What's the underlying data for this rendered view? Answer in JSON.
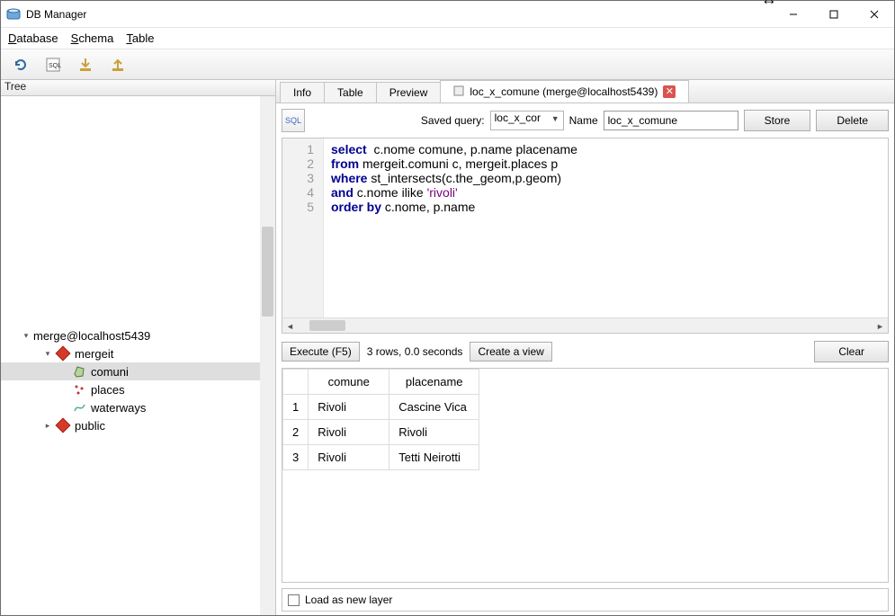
{
  "window": {
    "title": "DB Manager"
  },
  "menu": {
    "database": "Database",
    "schema": "Schema",
    "table": "Table"
  },
  "tree": {
    "header": "Tree",
    "connection": "merge@localhost5439",
    "schema_mergeit": "mergeit",
    "tbl_comuni": "comuni",
    "tbl_places": "places",
    "tbl_waterways": "waterways",
    "schema_public": "public"
  },
  "tabs": {
    "info": "Info",
    "table": "Table",
    "preview": "Preview",
    "query": "loc_x_comune (merge@localhost5439)"
  },
  "query": {
    "saved_query_label": "Saved query:",
    "saved_query_value": "loc_x_cor",
    "name_label": "Name",
    "name_value": "loc_x_comune",
    "store": "Store",
    "delete": "Delete",
    "lines": [
      "1",
      "2",
      "3",
      "4",
      "5"
    ],
    "sql": {
      "l1_kw1": "select",
      "l1_rest": "  c.nome comune, p.name placename",
      "l2_kw1": "from",
      "l2_rest": " mergeit.comuni c, mergeit.places p",
      "l3_kw1": "where",
      "l3_rest": " st_intersects(c.the_geom,p.geom)",
      "l4_kw1": "and",
      "l4_rest_a": " c.nome ilike ",
      "l4_str": "'rivoli'",
      "l5_kw1": "order by",
      "l5_rest": " c.nome, p.name"
    },
    "execute": "Execute (F5)",
    "status": "3 rows, 0.0 seconds",
    "create_view": "Create a view",
    "clear": "Clear"
  },
  "results": {
    "columns": [
      "comune",
      "placename"
    ],
    "rows": [
      {
        "n": "1",
        "comune": "Rivoli",
        "placename": "Cascine Vica"
      },
      {
        "n": "2",
        "comune": "Rivoli",
        "placename": "Rivoli"
      },
      {
        "n": "3",
        "comune": "Rivoli",
        "placename": "Tetti Neirotti"
      }
    ]
  },
  "footer": {
    "load_as_new_layer": "Load as new layer"
  }
}
